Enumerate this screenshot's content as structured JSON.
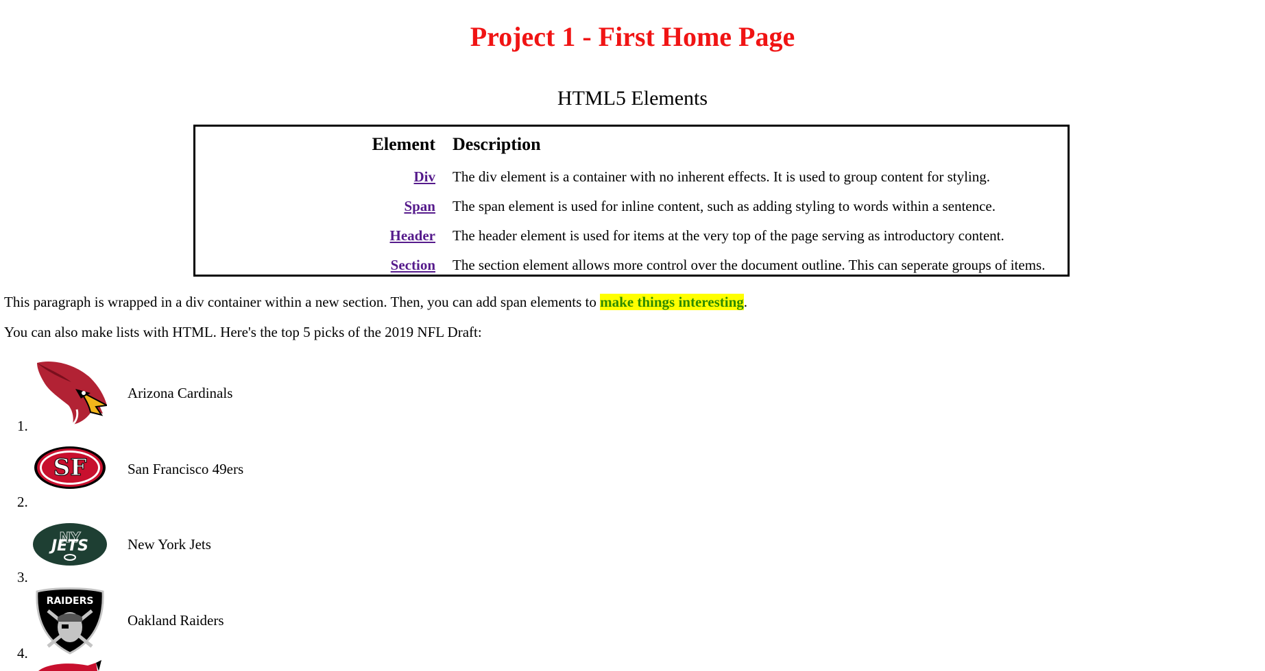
{
  "page": {
    "title": "Project 1 - First Home Page",
    "subtitle": "HTML5 Elements"
  },
  "table": {
    "headers": [
      "Element",
      "Description"
    ],
    "rows": [
      {
        "element": "Div",
        "description": "The div element is a container with no inherent effects. It is used to group content for styling."
      },
      {
        "element": "Span",
        "description": "The span element is used for inline content, such as adding styling to words within a sentence."
      },
      {
        "element": "Header",
        "description": "The header element is used for items at the very top of the page serving as introductory content."
      },
      {
        "element": "Section",
        "description": "The section element allows more control over the document outline. This can seperate groups of items."
      }
    ]
  },
  "paragraph1": {
    "before": "This paragraph is wrapped in a div container within a new section. Then, you can add span elements to ",
    "highlight": "make things interesting",
    "after": "."
  },
  "paragraph2": "You can also make lists with HTML. Here's the top 5 picks of the 2019 NFL Draft:",
  "draft_list": [
    {
      "number": "1.",
      "team": "Arizona Cardinals",
      "icon": "cardinals-logo-icon"
    },
    {
      "number": "2.",
      "team": "San Francisco 49ers",
      "icon": "49ers-logo-icon"
    },
    {
      "number": "3.",
      "team": "New York Jets",
      "icon": "jets-logo-icon"
    },
    {
      "number": "4.",
      "team": "Oakland Raiders",
      "icon": "raiders-logo-icon"
    }
  ],
  "colors": {
    "title": "#f01414",
    "link": "#551a8b",
    "highlight_bg": "#ffff00",
    "highlight_text": "#2e8b00"
  }
}
